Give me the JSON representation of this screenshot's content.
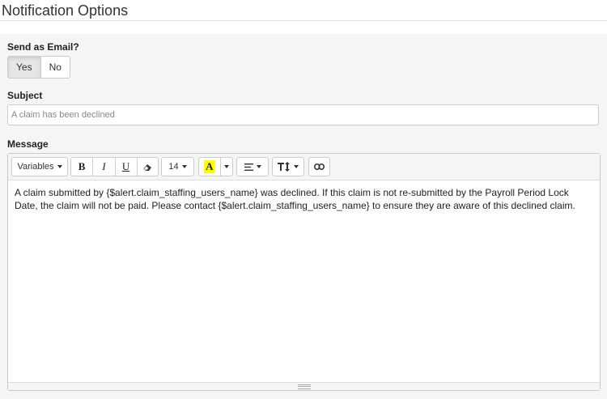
{
  "page": {
    "title": "Notification Options"
  },
  "send_email": {
    "label": "Send as Email?",
    "options": [
      "Yes",
      "No"
    ],
    "selected": "Yes"
  },
  "subject": {
    "label": "Subject",
    "placeholder": "A claim has been declined"
  },
  "message": {
    "label": "Message",
    "toolbar": {
      "variables_label": "Variables",
      "bold": "B",
      "italic": "I",
      "underline": "U",
      "font_size": "14",
      "highlight": "A"
    },
    "body": "A claim submitted by {$alert.claim_staffing_users_name} was declined.  If this claim is not re-submitted by the Payroll Period Lock Date, the claim will not be paid.  Please contact {$alert.claim_staffing_users_name} to ensure they are aware of this declined claim."
  },
  "colors": {
    "panel_bg": "#f5f5f5",
    "highlight_yellow": "#ffff00"
  }
}
